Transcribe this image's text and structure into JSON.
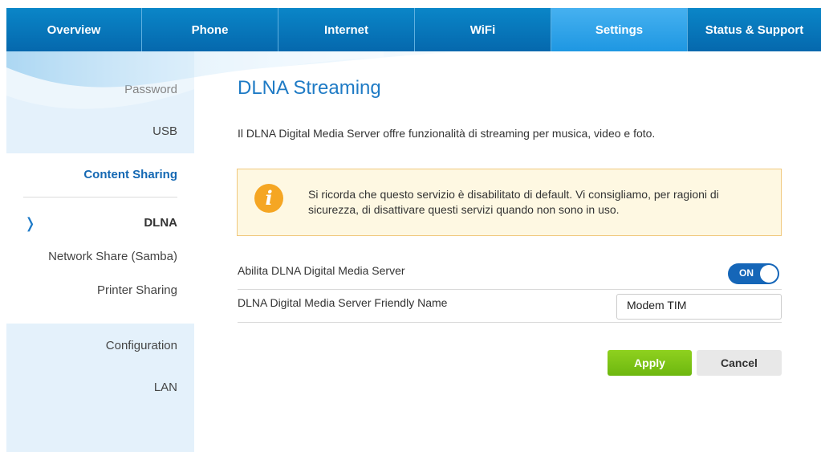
{
  "nav": {
    "tabs": [
      {
        "label": "Overview"
      },
      {
        "label": "Phone"
      },
      {
        "label": "Internet"
      },
      {
        "label": "WiFi"
      },
      {
        "label": "Settings",
        "active": true
      },
      {
        "label": "Status & Support"
      }
    ]
  },
  "sidebar": {
    "password": "Password",
    "usb": "USB",
    "content_sharing": "Content Sharing",
    "dlna": "DLNA",
    "samba": "Network Share (Samba)",
    "printer": "Printer Sharing",
    "configuration": "Configuration",
    "lan": "LAN"
  },
  "main": {
    "title": "DLNA Streaming",
    "description": "Il DLNA Digital Media Server offre funzionalità di streaming per musica, video e foto.",
    "notice": "Si ricorda che questo servizio è disabilitato di default. Vi consigliamo, per ragioni di sicurezza, di disattivare questi servizi quando non sono in uso.",
    "notice_icon": "i",
    "enable_label": "Abilita DLNA Digital Media Server",
    "enable_toggle": "ON",
    "name_label": "DLNA Digital Media Server Friendly Name",
    "name_value": "Modem TIM",
    "apply": "Apply",
    "cancel": "Cancel"
  },
  "colors": {
    "nav_bg": "#0a7cc1",
    "nav_active": "#2aa1e8",
    "title": "#1f7bc5",
    "apply_green": "#7cc415",
    "toggle_blue": "#1566b8",
    "notice_bg": "#fef8e2",
    "notice_icon": "#f5a623"
  }
}
